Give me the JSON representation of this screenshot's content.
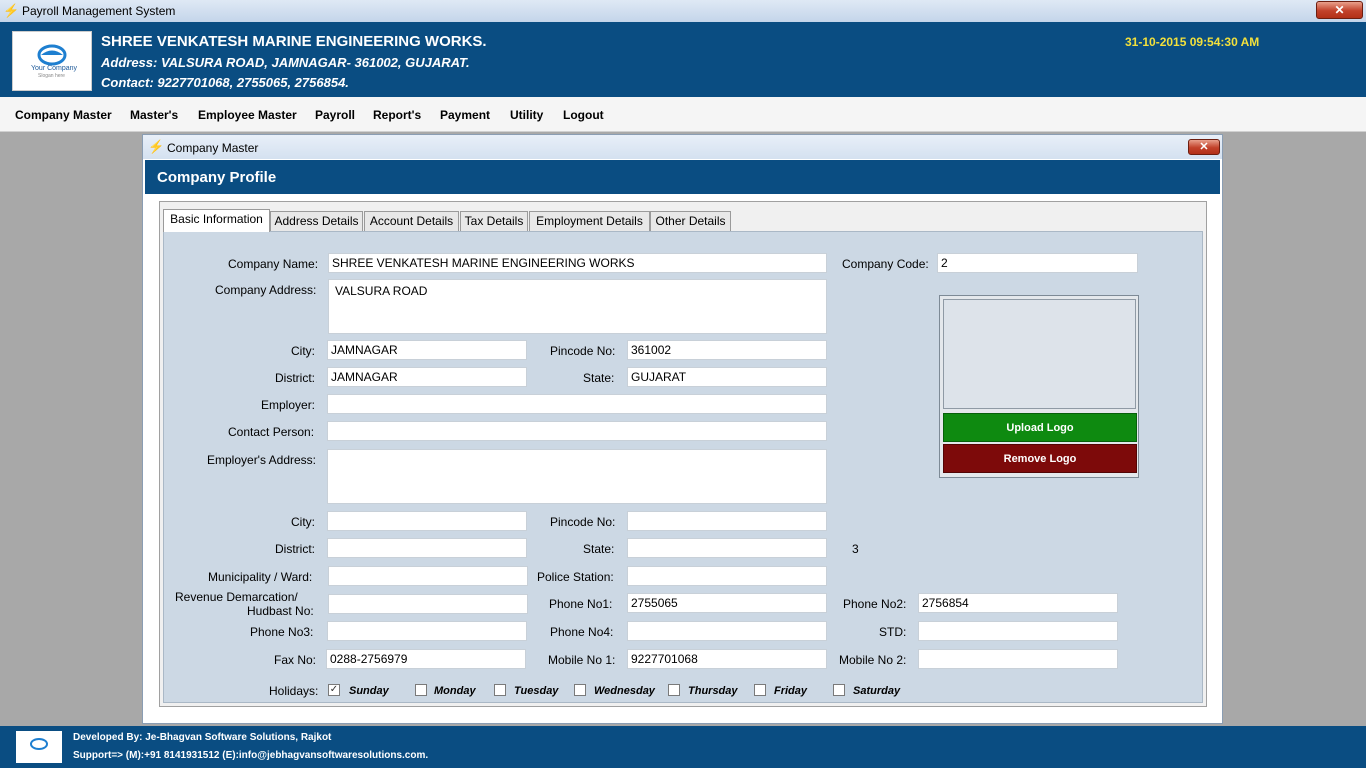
{
  "window": {
    "title": "Payroll Management System",
    "close": "✕"
  },
  "header": {
    "logo_text": "Your Company",
    "logo_tagline": "Slogan here",
    "company_name": "SHREE VENKATESH MARINE ENGINEERING WORKS.",
    "address": "Address: VALSURA ROAD, JAMNAGAR- 361002, GUJARAT.",
    "contact": "Contact: 9227701068, 2755065, 2756854.",
    "datetime": "31-10-2015 09:54:30 AM"
  },
  "menu": [
    "Company Master",
    "Master's",
    "Employee Master",
    "Payroll",
    "Report's",
    "Payment",
    "Utility",
    "Logout"
  ],
  "child": {
    "title": "Company Master",
    "close": "✕",
    "profile_title": "Company Profile"
  },
  "tabs": [
    "Basic Information",
    "Address Details",
    "Account Details",
    "Tax Details",
    "Employment Details",
    "Other Details"
  ],
  "form": {
    "company_name_label": "Company Name:",
    "company_name": "SHREE VENKATESH MARINE ENGINEERING WORKS",
    "company_code_label": "Company Code:",
    "company_code": "2",
    "company_address_label": "Company Address:",
    "company_address": "VALSURA ROAD",
    "city_label": "City:",
    "city": "JAMNAGAR",
    "pincode_label": "Pincode No:",
    "pincode": "361002",
    "district_label": "District:",
    "district": "JAMNAGAR",
    "state_label": "State:",
    "state": "GUJARAT",
    "employer_label": "Employer:",
    "employer": "",
    "contact_person_label": "Contact Person:",
    "contact_person": "",
    "employer_address_label": "Employer's Address:",
    "employer_address": "",
    "emp_city_label": "City:",
    "emp_city": "",
    "emp_pincode_label": "Pincode No:",
    "emp_pincode": "",
    "emp_district_label": "District:",
    "emp_district": "",
    "emp_state_label": "State:",
    "emp_state": "",
    "stray_number": "3",
    "municipality_label": "Municipality / Ward:",
    "municipality": "",
    "police_station_label": "Police Station:",
    "police_station": "",
    "revenue_label_1": "Revenue Demarcation/",
    "revenue_label_2": "Hudbast No:",
    "revenue": "",
    "phone1_label": "Phone No1:",
    "phone1": "2755065",
    "phone2_label": "Phone No2:",
    "phone2": "2756854",
    "phone3_label": "Phone No3:",
    "phone3": "",
    "phone4_label": "Phone No4:",
    "phone4": "",
    "std_label": "STD:",
    "std": "",
    "fax_label": "Fax No:",
    "fax": "0288-2756979",
    "mobile1_label": "Mobile No 1:",
    "mobile1": "9227701068",
    "mobile2_label": "Mobile No 2:",
    "mobile2": "",
    "holidays_label": "Holidays:",
    "holidays": [
      {
        "day": "Sunday",
        "checked": true
      },
      {
        "day": "Monday",
        "checked": false
      },
      {
        "day": "Tuesday",
        "checked": false
      },
      {
        "day": "Wednesday",
        "checked": false
      },
      {
        "day": "Thursday",
        "checked": false
      },
      {
        "day": "Friday",
        "checked": false
      },
      {
        "day": "Saturday",
        "checked": false
      }
    ],
    "check_mark": "✓"
  },
  "logo_panel": {
    "upload_label": "Upload Logo",
    "remove_label": "Remove Logo"
  },
  "footer": {
    "developed_by": "Developed By: Je-Bhagvan Software Solutions, Rajkot",
    "support": "Support=> (M):+91 8141931512 (E):info@jebhagvansoftwaresolutions.com."
  },
  "colors": {
    "header_bg": "#0a4d82",
    "datetime": "#f2e03c",
    "upload": "#0e8a10",
    "remove": "#7d0a0a"
  }
}
